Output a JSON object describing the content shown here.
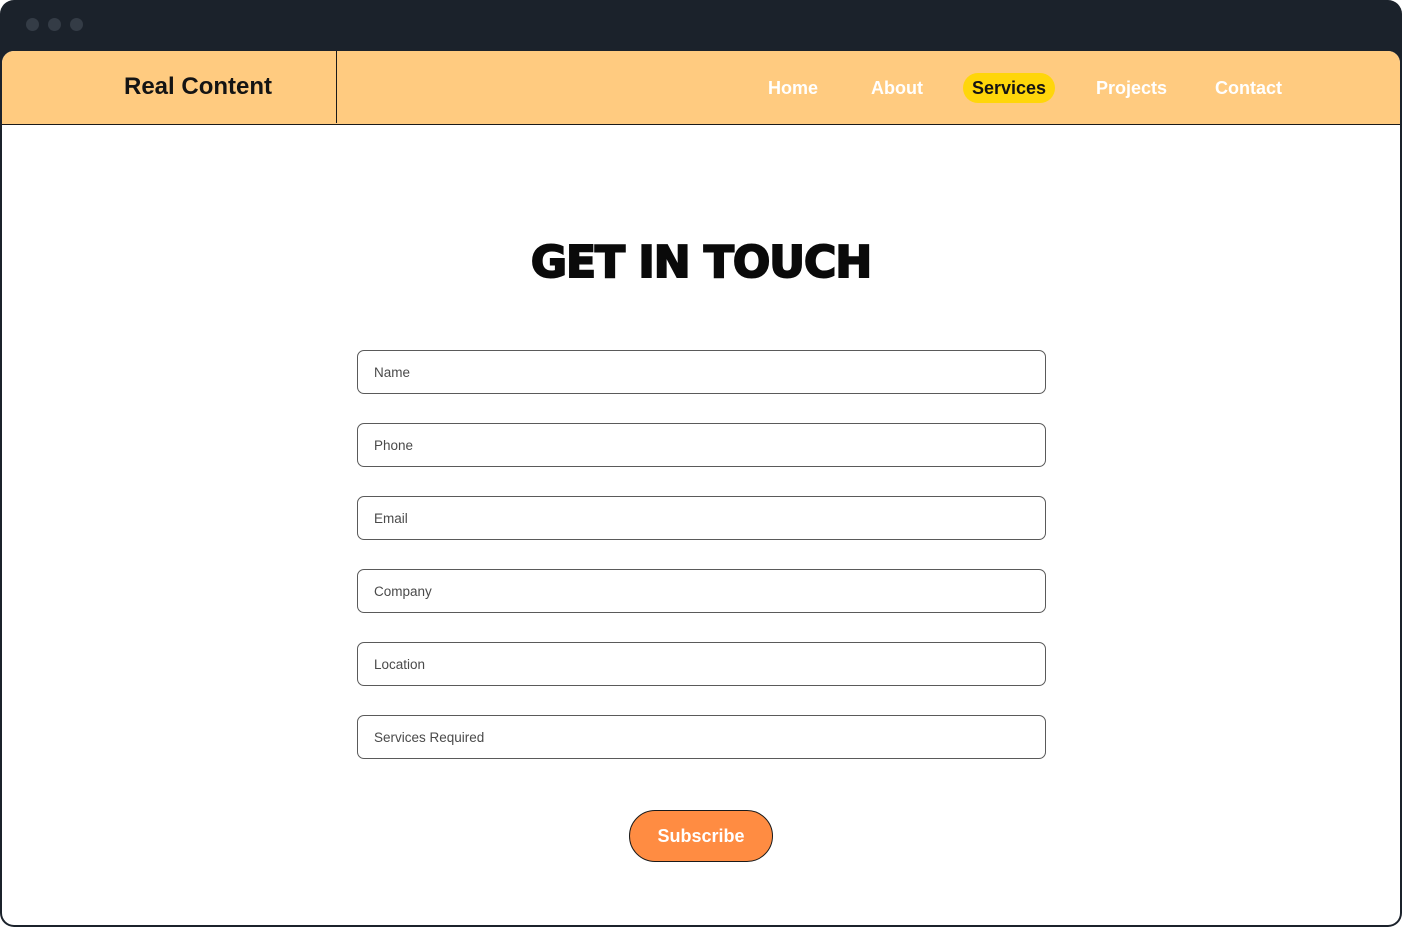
{
  "brand": "Real Content",
  "nav": {
    "home": "Home",
    "about": "About",
    "services": "Services",
    "projects": "Projects",
    "contact": "Contact",
    "active": "Services"
  },
  "heading": "GET IN TOUCH",
  "form": {
    "name_placeholder": "Name",
    "phone_placeholder": "Phone",
    "email_placeholder": "Email",
    "company_placeholder": "Company",
    "location_placeholder": "Location",
    "services_placeholder": "Services Required",
    "submit_label": "Subscribe"
  },
  "colors": {
    "window_chrome": "#1b222b",
    "navbar_bg": "#ffcb80",
    "active_pill": "#ffd60a",
    "button_bg": "#ff8c42"
  }
}
